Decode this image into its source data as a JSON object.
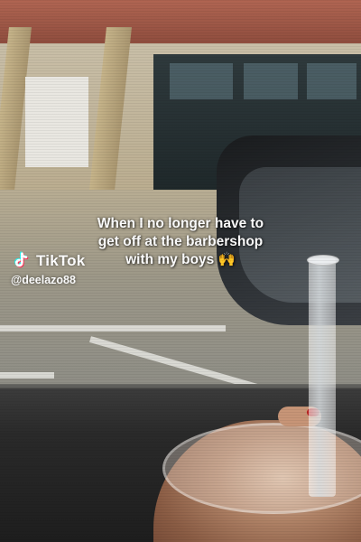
{
  "caption": {
    "line1": "When I no longer have to",
    "line2": "get off at the barbershop",
    "line3": "with my boys 🙌"
  },
  "watermark": {
    "app_name": "TikTok",
    "handle": "@deelazo88",
    "logo_icon": "tiktok-note-icon"
  },
  "colors": {
    "tiktok_cyan": "#25f4ee",
    "tiktok_red": "#fe2c55",
    "text": "#ffffff"
  }
}
